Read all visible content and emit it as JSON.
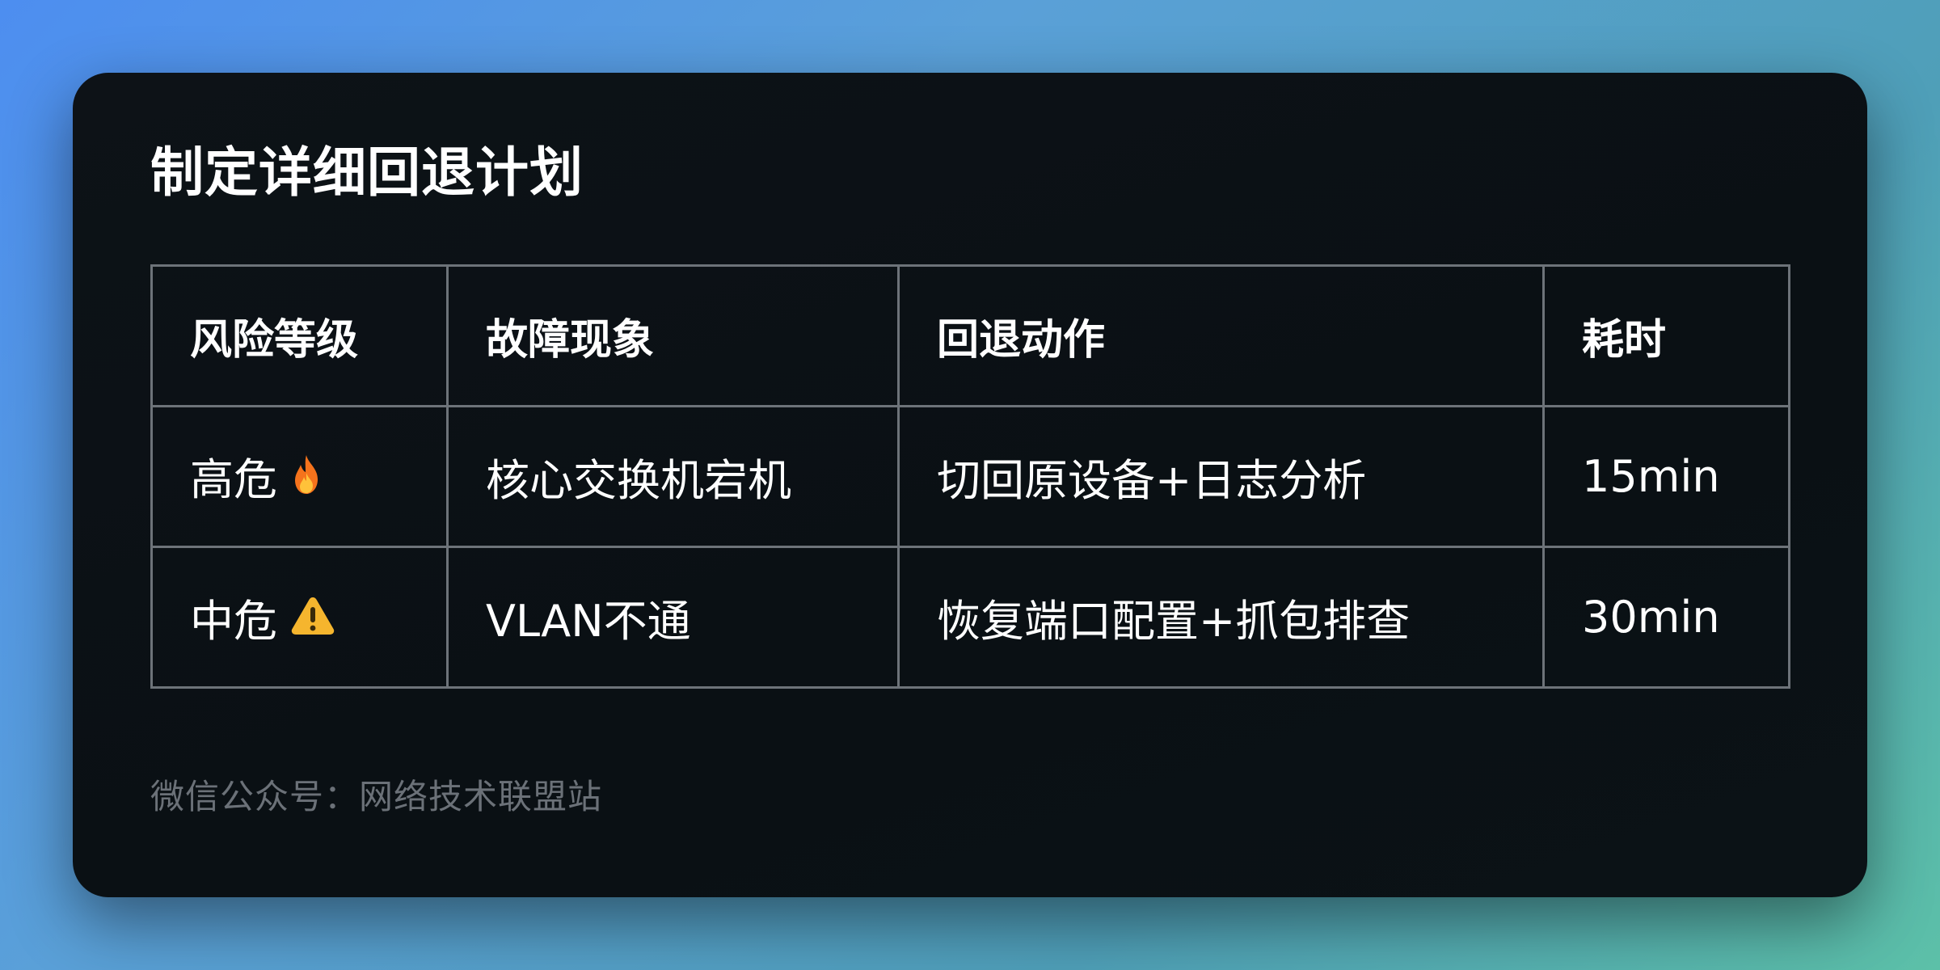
{
  "title": "制定详细回退计划",
  "table": {
    "headers": [
      "风险等级",
      "故障现象",
      "回退动作",
      "耗时"
    ],
    "rows": [
      {
        "level": "高危",
        "level_icon": "fire-icon",
        "symptom": "核心交换机宕机",
        "action": "切回原设备+日志分析",
        "duration": "15min"
      },
      {
        "level": "中危",
        "level_icon": "warning-icon",
        "symptom": "VLAN不通",
        "action": "恢复端口配置+抓包排查",
        "duration": "30min"
      }
    ]
  },
  "footer": "微信公众号：网络技术联盟站",
  "colors": {
    "card_background": "#0b1115",
    "grid_line": "#6d7379",
    "footer_text": "#6b7178",
    "fire": "#f57c1f",
    "warning": "#f5b52e"
  }
}
